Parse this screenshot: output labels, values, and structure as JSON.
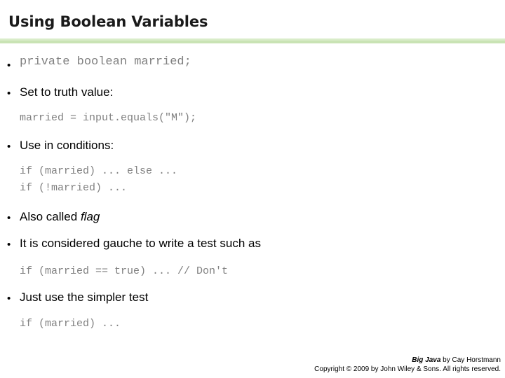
{
  "slide": {
    "title": "Using Boolean Variables",
    "accent_color": "#c9e3b4",
    "code_color": "#808080",
    "text_color": "#000000",
    "background_color": "#ffffff"
  },
  "content": {
    "bullet_glyph": "•",
    "items": [
      {
        "kind": "bullet-code",
        "text": "private boolean married;"
      },
      {
        "kind": "bullet",
        "text": "Set to truth value:"
      },
      {
        "kind": "code",
        "text": "married = input.equals(\"M\");"
      },
      {
        "kind": "bullet",
        "text": "Use in conditions:"
      },
      {
        "kind": "code",
        "text": "if (married) ... else ...\nif (!married) ..."
      },
      {
        "kind": "bullet-italic-tail",
        "text": "Also called ",
        "italic_text": "flag"
      },
      {
        "kind": "bullet",
        "text": "It is considered gauche to write a test such as"
      },
      {
        "kind": "code",
        "text": "if (married == true) ... // Don't"
      },
      {
        "kind": "bullet",
        "text": "Just use the simpler test"
      },
      {
        "kind": "code",
        "text": "if (married) ..."
      }
    ]
  },
  "footer": {
    "line1_italic": "Big Java",
    "line1_rest": " by Cay Horstmann",
    "line2": "Copyright © 2009 by John Wiley & Sons.  All rights reserved."
  }
}
